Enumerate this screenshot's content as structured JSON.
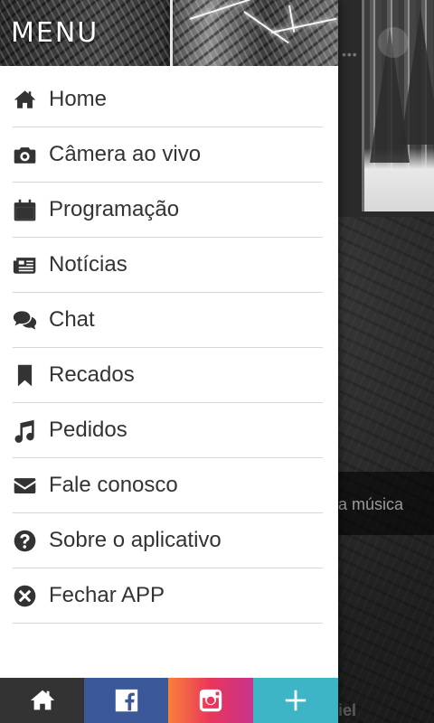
{
  "drawer": {
    "title": "MENU",
    "items": [
      {
        "label": "Home",
        "icon": "home-icon"
      },
      {
        "label": "Câmera ao vivo",
        "icon": "camera-icon"
      },
      {
        "label": "Programação",
        "icon": "calendar-icon"
      },
      {
        "label": "Notícias",
        "icon": "newspaper-icon"
      },
      {
        "label": "Chat",
        "icon": "chat-icon"
      },
      {
        "label": "Recados",
        "icon": "bookmark-icon"
      },
      {
        "label": "Pedidos",
        "icon": "music-note-icon"
      },
      {
        "label": "Fale conosco",
        "icon": "envelope-icon"
      },
      {
        "label": "Sobre o aplicativo",
        "icon": "question-circle-icon"
      },
      {
        "label": "Fechar APP",
        "icon": "close-circle-icon"
      }
    ]
  },
  "background_app": {
    "strip_text": "a música",
    "bottom_text": "iel"
  },
  "bottom_bar": {
    "buttons": [
      {
        "icon": "home-icon",
        "color": "#333333"
      },
      {
        "icon": "facebook-icon",
        "color": "#3b5998"
      },
      {
        "icon": "instagram-icon",
        "color": "#e9355b"
      },
      {
        "icon": "plus-icon",
        "color": "#3db5c7"
      }
    ]
  },
  "colors": {
    "drawer_bg": "#ffffff",
    "text": "#333333",
    "divider": "#d6d6d6"
  }
}
